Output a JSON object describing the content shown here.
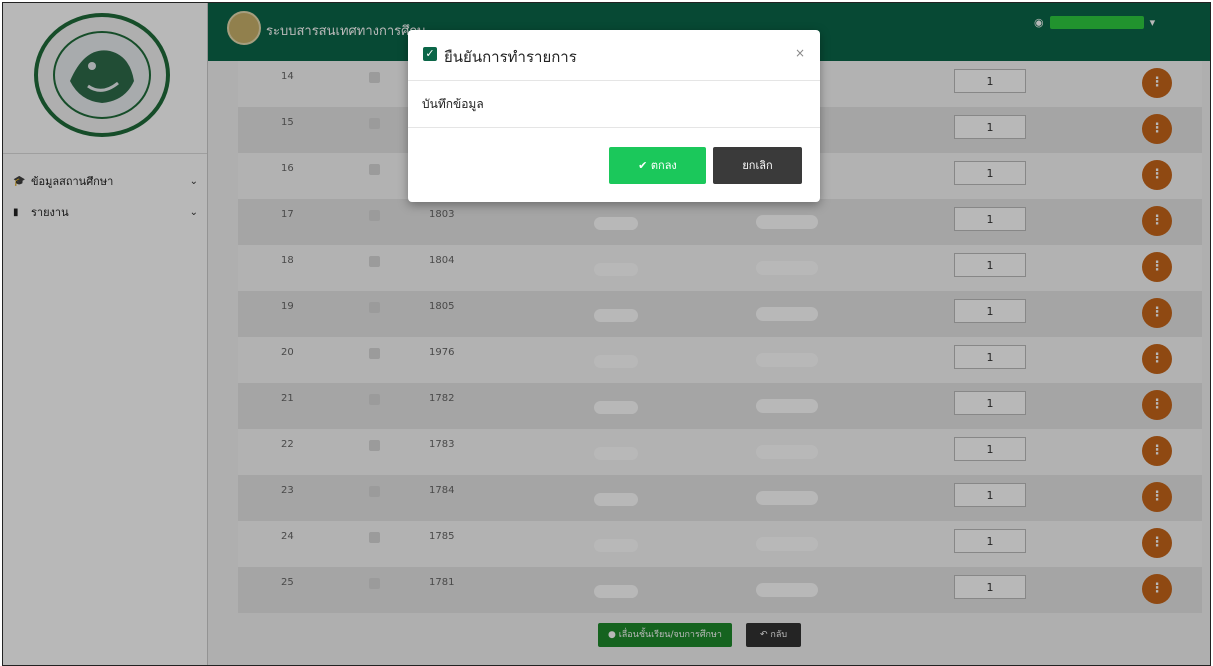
{
  "header": {
    "title": "ระบบสารสนเทศทางการศึกษ",
    "user_caret": "▾"
  },
  "sidebar": {
    "items": [
      {
        "icon": "graduation-cap-icon",
        "label": "ข้อมูลสถานศึกษา"
      },
      {
        "icon": "file-icon",
        "label": "รายงาน"
      }
    ]
  },
  "table": {
    "rows": [
      {
        "no": "14",
        "code": "",
        "qty": "1"
      },
      {
        "no": "15",
        "code": "",
        "qty": "1"
      },
      {
        "no": "16",
        "code": "",
        "qty": "1"
      },
      {
        "no": "17",
        "code": "1803",
        "qty": "1"
      },
      {
        "no": "18",
        "code": "1804",
        "qty": "1"
      },
      {
        "no": "19",
        "code": "1805",
        "qty": "1"
      },
      {
        "no": "20",
        "code": "1976",
        "qty": "1"
      },
      {
        "no": "21",
        "code": "1782",
        "qty": "1"
      },
      {
        "no": "22",
        "code": "1783",
        "qty": "1"
      },
      {
        "no": "23",
        "code": "1784",
        "qty": "1"
      },
      {
        "no": "24",
        "code": "1785",
        "qty": "1"
      },
      {
        "no": "25",
        "code": "1781",
        "qty": "1"
      }
    ]
  },
  "footer": {
    "promote_label": "เลื่อนชั้นเรียน/จบการศึกษา",
    "back_label": "กลับ"
  },
  "modal": {
    "title": "ยืนยันการทำรายการ",
    "close": "×",
    "message": "บันทึกข้อมูล",
    "ok_label": "✔ ตกลง",
    "cancel_label": "ยกเลิก"
  },
  "colors": {
    "header_green": "#0b6648",
    "ok_green": "#1bc85b",
    "action_orange": "#c7661a"
  }
}
